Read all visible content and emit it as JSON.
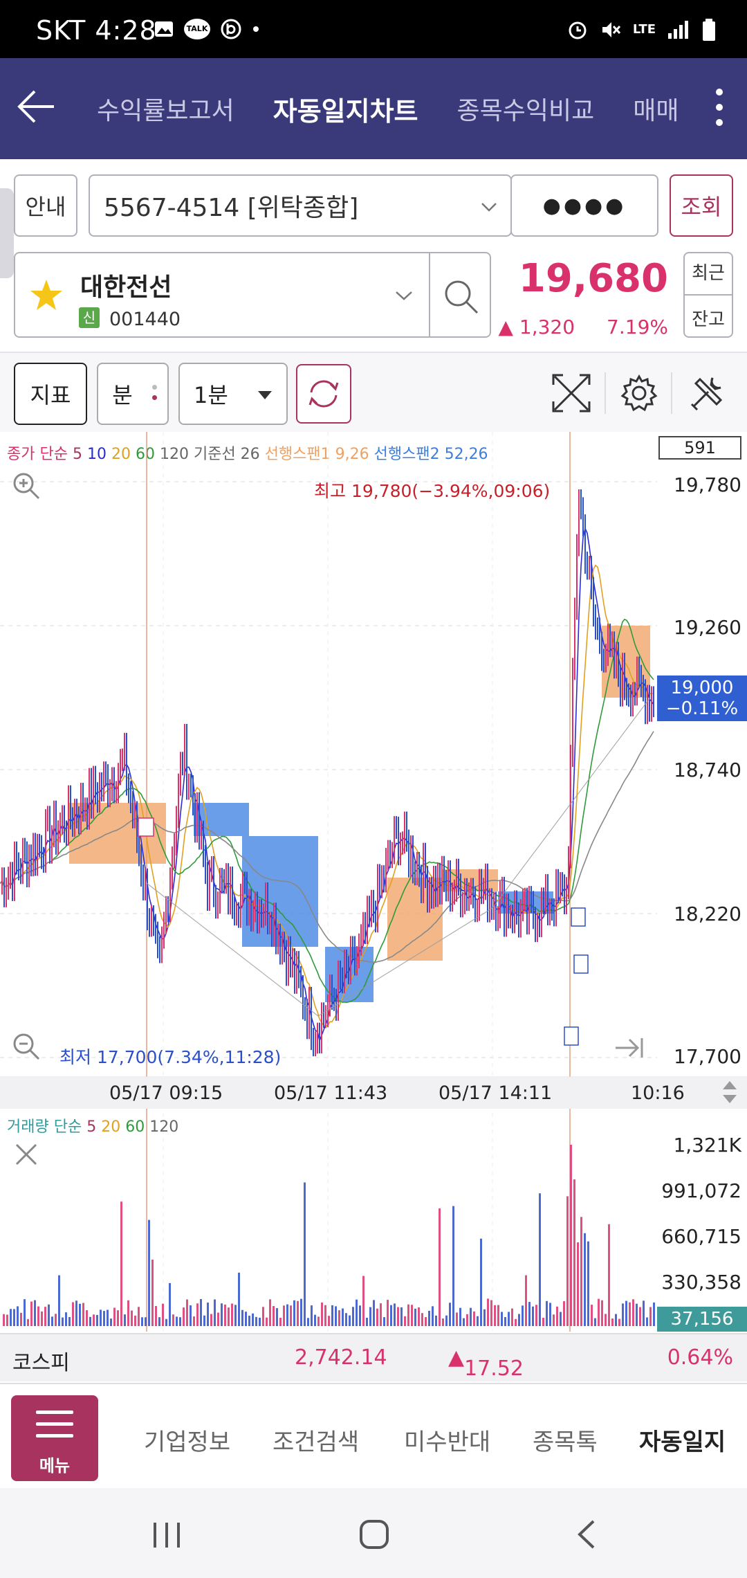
{
  "status": {
    "carrier_time": "SKT 4:28",
    "talk_badge": "TALK",
    "network": "LTE"
  },
  "header": {
    "tabs": [
      {
        "label": "수익률보고서"
      },
      {
        "label": "자동일지차트"
      },
      {
        "label": "종목수익비교"
      },
      {
        "label": "매매"
      }
    ],
    "active_tab": 1
  },
  "account": {
    "info_label": "안내",
    "account_number": "5567-4514 [위탁종합]",
    "password_mask": "●●●●",
    "query_label": "조회"
  },
  "stock": {
    "name": "대한전선",
    "badge": "신",
    "code": "001440",
    "price": "19,680",
    "change": "1,320",
    "change_pct": "7.19%",
    "recent_label": "최근",
    "balance_label": "잔고"
  },
  "toolbar": {
    "indicator_label": "지표",
    "unit_label": "분",
    "interval_value": "1분"
  },
  "chart": {
    "count_box": "591",
    "price_legend": {
      "prefix": "종가 단순",
      "ma5": "5",
      "ma10": "10",
      "ma20": "20",
      "ma60": "60",
      "ma120": "120",
      "base": "기준선 26",
      "span1": "선행스팬1 9,26",
      "span2": "선행스팬2 52,26"
    },
    "high_note": "최고 19,780(−3.94%,09:06)",
    "low_note": "최저 17,700(7.34%,11:28)",
    "current_price": "19,000",
    "current_change": "−0.11%",
    "y_ticks": [
      "19,780",
      "19,260",
      "18,740",
      "18,220",
      "17,700"
    ],
    "x_ticks": [
      "05/17 09:15",
      "05/17 11:43",
      "05/17 14:11",
      "10:16"
    ],
    "volume_legend": {
      "prefix": "거래량 단순",
      "ma5": "5",
      "ma20": "20",
      "ma60": "60",
      "ma120": "120"
    },
    "volume_ticks": [
      "1,321K",
      "991,072",
      "660,715",
      "330,358"
    ],
    "current_volume": "37,156",
    "colors": {
      "up": "#d8316b",
      "down": "#2b4fc8",
      "span1": "#f0a060",
      "span2": "#3a7ee0"
    }
  },
  "chart_data": {
    "type": "line",
    "title": "",
    "xlabel": "",
    "ylabel": "",
    "x": [
      "05/17 09:15",
      "05/17 11:43",
      "05/17 14:11",
      "10:16"
    ],
    "ylim": [
      17700,
      19780
    ],
    "series": [
      {
        "name": "종가",
        "values": [
          18330,
          17850,
          18240,
          19000
        ]
      }
    ]
  },
  "kospi": {
    "label": "코스피",
    "value": "2,742.14",
    "change": "17.52",
    "change_pct": "0.64%"
  },
  "bottom_nav": {
    "menu_label": "메뉴",
    "items": [
      {
        "label": "기업정보"
      },
      {
        "label": "조건검색"
      },
      {
        "label": "미수반대"
      },
      {
        "label": "종목톡"
      },
      {
        "label": "자동일지"
      }
    ]
  }
}
